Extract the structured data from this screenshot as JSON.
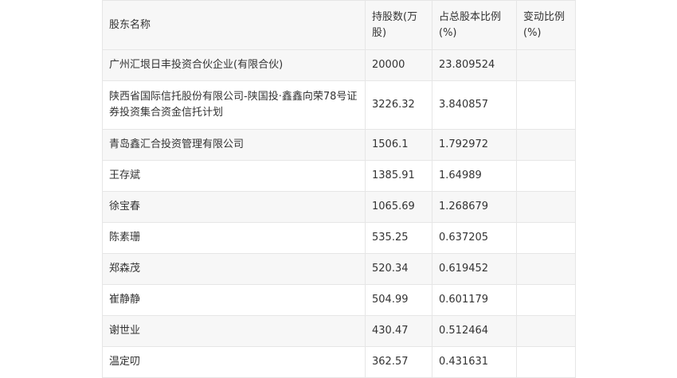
{
  "table": {
    "headers": [
      "股东名称",
      "持股数(万股)",
      "占总股本比例(%)",
      "变动比例(%)"
    ],
    "rows": [
      {
        "name": "广州汇垠日丰投资合伙企业(有限合伙)",
        "shares": "20000",
        "ratio": "23.809524",
        "change": ""
      },
      {
        "name": "陕西省国际信托股份有限公司-陕国投·鑫鑫向荣78号证券投资集合资金信托计划",
        "shares": "3226.32",
        "ratio": "3.840857",
        "change": ""
      },
      {
        "name": "青岛鑫汇合投资管理有限公司",
        "shares": "1506.1",
        "ratio": "1.792972",
        "change": ""
      },
      {
        "name": "王存斌",
        "shares": "1385.91",
        "ratio": "1.64989",
        "change": ""
      },
      {
        "name": "徐宝春",
        "shares": "1065.69",
        "ratio": "1.268679",
        "change": ""
      },
      {
        "name": "陈素珊",
        "shares": "535.25",
        "ratio": "0.637205",
        "change": ""
      },
      {
        "name": "郑森茂",
        "shares": "520.34",
        "ratio": "0.619452",
        "change": ""
      },
      {
        "name": "崔静静",
        "shares": "504.99",
        "ratio": "0.601179",
        "change": ""
      },
      {
        "name": "谢世业",
        "shares": "430.47",
        "ratio": "0.512464",
        "change": ""
      },
      {
        "name": "温定叨",
        "shares": "362.57",
        "ratio": "0.431631",
        "change": ""
      }
    ]
  }
}
